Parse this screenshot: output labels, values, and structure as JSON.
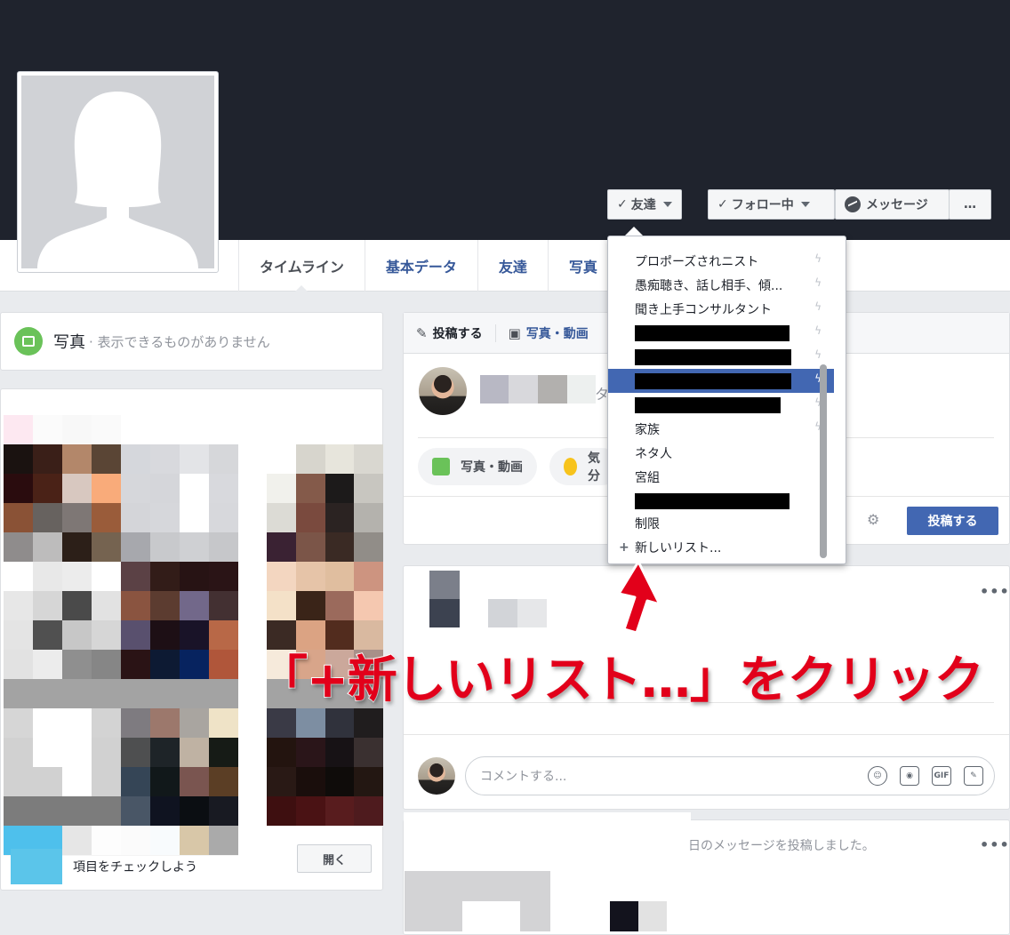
{
  "profile": {
    "nav_tabs": [
      "タイムライン",
      "基本データ",
      "友達",
      "写真"
    ],
    "friends_button": "友達",
    "follow_button": "フォロー中",
    "message_button": "メッセージ",
    "more_button": "…"
  },
  "photos_card": {
    "title": "写真",
    "subtitle": "· 表示できるものがありません"
  },
  "composer": {
    "tab_post": "投稿する",
    "tab_photo": "写真・動画",
    "pill_photo": "写真・動画",
    "pill_feeling": "気分",
    "post_button": "投稿する",
    "partial_text": "タ"
  },
  "friend_list_menu": {
    "items": [
      {
        "label": "プロポーズされニスト",
        "bolt": true,
        "active": false,
        "redacted": false
      },
      {
        "label": "愚痴聴き、話し相手、傾...",
        "bolt": true,
        "active": false,
        "redacted": false
      },
      {
        "label": "聞き上手コンサルタント",
        "bolt": true,
        "active": false,
        "redacted": false
      },
      {
        "label": "",
        "bolt": true,
        "active": false,
        "redacted": true
      },
      {
        "label": "",
        "bolt": true,
        "active": false,
        "redacted": true
      },
      {
        "label": "",
        "bolt": true,
        "active": true,
        "redacted": true
      },
      {
        "label": "",
        "bolt": true,
        "active": false,
        "redacted": true
      },
      {
        "label": "家族",
        "bolt": true,
        "active": false,
        "redacted": false
      },
      {
        "label": "ネタ人",
        "bolt": false,
        "active": false,
        "redacted": false
      },
      {
        "label": "宮組",
        "bolt": false,
        "active": false,
        "redacted": false
      },
      {
        "label": "",
        "bolt": false,
        "active": false,
        "redacted": true
      },
      {
        "label": "制限",
        "bolt": false,
        "active": false,
        "redacted": false
      }
    ],
    "new_list": "新しいリスト..."
  },
  "annotation": {
    "callout": "「+新しいリスト…」をクリック"
  },
  "feed": {
    "comment_placeholder": "コメントする...",
    "comment_icons": [
      "☺",
      "camera-icon",
      "GIF",
      "sticker-icon"
    ],
    "post_text": "日のメッセージを投稿しました。",
    "check_items_text": "項目をチェックしよう",
    "open_button": "開く"
  },
  "colors": {
    "cover": "#1f232d",
    "accent": "#4267b2",
    "callout": "#e2001a"
  }
}
